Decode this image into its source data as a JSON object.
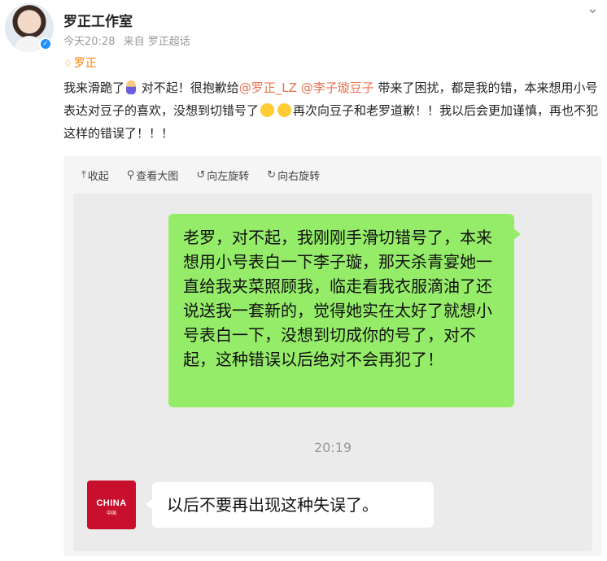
{
  "header": {
    "name": "罗正工作室",
    "time": "今天20:28",
    "source": "来自 罗正超话"
  },
  "tag": {
    "label": "罗正"
  },
  "post": {
    "t1": "我来滑跪了",
    "t2": " 对不起！很抱歉给",
    "mention1": "@罗正_LZ",
    "mention2": " @李子璇豆子",
    "t3": " 带来了困扰，都是我的错，本来想用小号表达对豆子的喜欢，没想到切错号了",
    "t4": "再次向豆子和老罗道歉！！我以后会更加谨慎，再也不犯这样的错误了！！！"
  },
  "toolbar": {
    "collapse": "收起",
    "view_large": "查看大图",
    "rotate_left": "向左旋转",
    "rotate_right": "向右旋转"
  },
  "chat": {
    "outgoing": "老罗，对不起，我刚刚手滑切错号了，本来想用小号表白一下李子璇，那天杀青宴她一直给我夹菜照顾我，临走看我衣服滴油了还说送我一套新的，觉得她实在太好了就想小号表白一下，没想到切成你的号了，对不起，这种错误以后绝对不会再犯了！",
    "timestamp": "20:19",
    "incoming": "以后不要再出现这种失误了。",
    "logo_text": "CHINA",
    "logo_sub": "中国"
  },
  "icons": {
    "verified": "verified-badge-icon",
    "chevron": "chevron-down-icon",
    "collapse": "arrow-up-icon",
    "view_large": "magnifier-icon",
    "rotate_left": "rotate-left-icon",
    "rotate_right": "rotate-right-icon"
  }
}
